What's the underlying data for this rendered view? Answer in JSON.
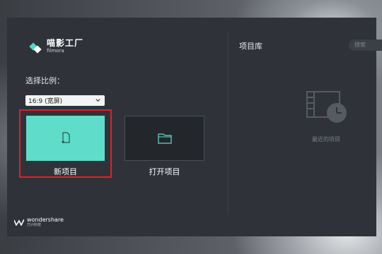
{
  "brand": {
    "title": "喵影工厂",
    "subtitle": "filmora"
  },
  "ratio": {
    "label": "选择比例：",
    "selected": "16:9 (宽屏)"
  },
  "actions": {
    "new_project": "新项目",
    "open_project": "打开项目"
  },
  "library": {
    "title": "项目库",
    "search_placeholder": "搜索",
    "empty_text": "最近的项目"
  },
  "footer": {
    "brand": "wondershare",
    "brand_sub": "万兴科技"
  },
  "colors": {
    "accent": "#5fdcca",
    "highlight": "#e0202a",
    "panel": "#2f3339"
  }
}
